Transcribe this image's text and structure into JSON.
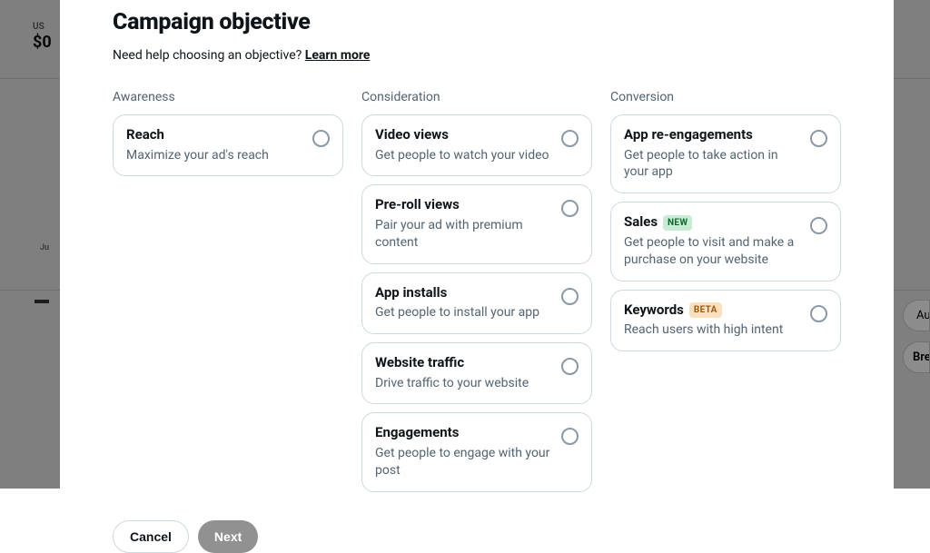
{
  "background": {
    "currency_label": "US",
    "amount": "$0",
    "side_label": "Ju",
    "btn1": "Au",
    "btn2": "Brea"
  },
  "modal": {
    "title": "Campaign objective",
    "help_text": "Need help choosing an objective? ",
    "learn_more": "Learn more",
    "columns": {
      "awareness": {
        "header": "Awareness",
        "items": [
          {
            "title": "Reach",
            "desc": "Maximize your ad's reach"
          }
        ]
      },
      "consideration": {
        "header": "Consideration",
        "items": [
          {
            "title": "Video views",
            "desc": "Get people to watch your video"
          },
          {
            "title": "Pre-roll views",
            "desc": "Pair your ad with premium content"
          },
          {
            "title": "App installs",
            "desc": "Get people to install your app"
          },
          {
            "title": "Website traffic",
            "desc": "Drive traffic to your website"
          },
          {
            "title": "Engagements",
            "desc": "Get people to engage with your post"
          }
        ]
      },
      "conversion": {
        "header": "Conversion",
        "items": [
          {
            "title": "App re-engagements",
            "desc": "Get people to take action in your app"
          },
          {
            "title": "Sales",
            "badge": "NEW",
            "desc": "Get people to visit and make a purchase on your website"
          },
          {
            "title": "Keywords",
            "badge": "BETA",
            "desc": "Reach users with high intent"
          }
        ]
      }
    },
    "footer": {
      "cancel": "Cancel",
      "next": "Next"
    }
  }
}
